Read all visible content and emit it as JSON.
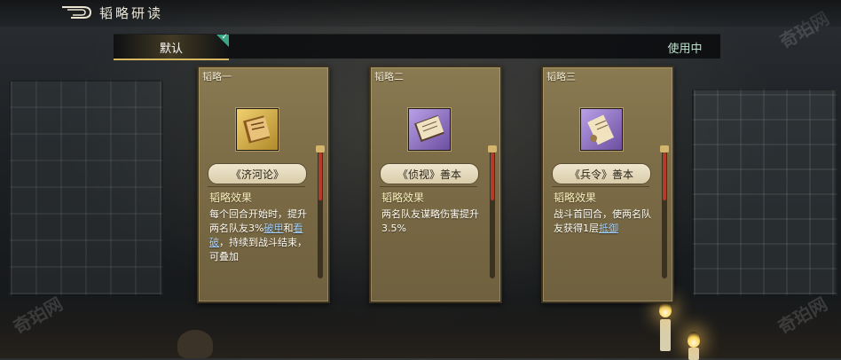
{
  "header": {
    "title": "韬略研读",
    "back_icon": "back-arrow-icon"
  },
  "tabs": {
    "default_label": "默认",
    "status_label": "使用中",
    "check_icon": "check-icon",
    "check_color": "#3ca584"
  },
  "cards": [
    {
      "tag": "韬略一",
      "icon": "scroll-book-icon",
      "icon_tier": "gold",
      "name": "《济河论》",
      "effect_heading": "韬略效果",
      "desc_1": "每个回合开始时，提升两名队友3%",
      "kw_1": "破甲",
      "desc_2": "和",
      "kw_2": "看破",
      "desc_3": "，持续到战斗结束，可叠加"
    },
    {
      "tag": "韬略二",
      "icon": "scroll-book-icon",
      "icon_tier": "purple",
      "name": "《侦视》善本",
      "effect_heading": "韬略效果",
      "desc_1": "两名队友谋略伤害提升3.5%"
    },
    {
      "tag": "韬略三",
      "icon": "scroll-icon",
      "icon_tier": "purple",
      "name": "《兵令》善本",
      "effect_heading": "韬略效果",
      "desc_1": "战斗首回合，使两名队友获得1层",
      "kw_1": "抵御"
    }
  ],
  "colors": {
    "keyword": "#9fd0ff",
    "card_bg": "#7a6a45",
    "scroll_thumb": "#b33b2a"
  },
  "watermark": "奇珀网"
}
